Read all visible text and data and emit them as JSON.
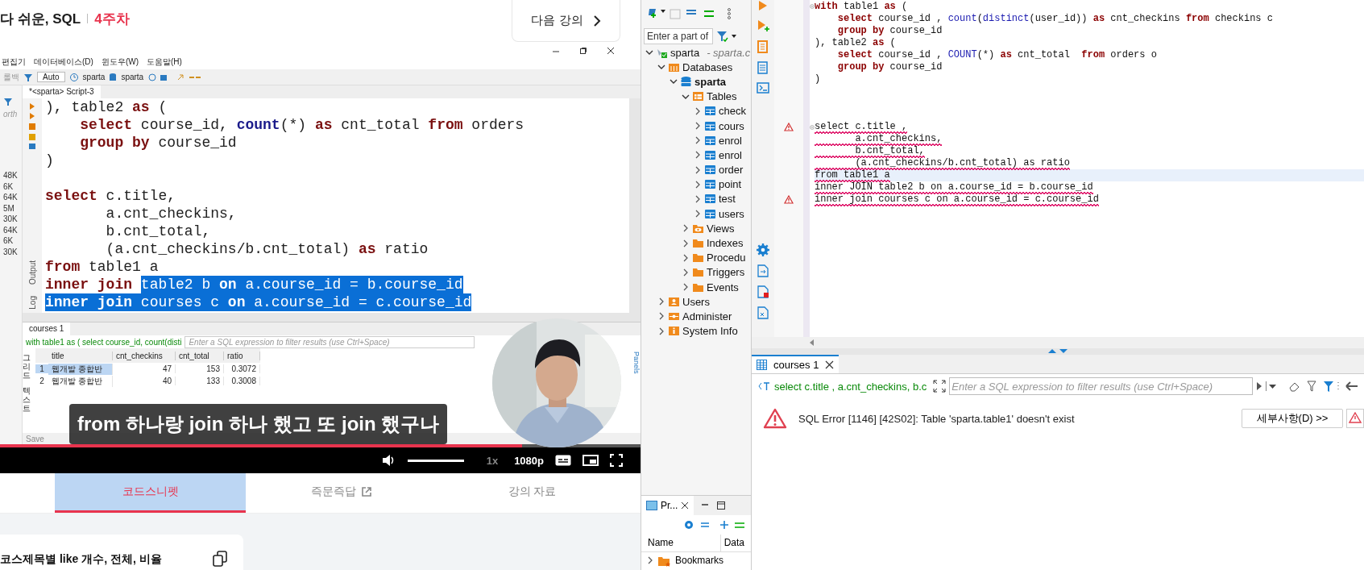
{
  "lesson_header": {
    "course": "다 쉬운, SQL",
    "week": "4주차",
    "next_button": "다음 강의"
  },
  "video": {
    "app": {
      "menu": [
        "편집기",
        "데이터베이스(D)",
        "윈도우(W)",
        "도움말(H)"
      ],
      "toolbar": {
        "rollback": "롤백",
        "commit_mode": "Auto",
        "datasource": "sparta",
        "schema": "sparta"
      },
      "side_label": "orth",
      "side_values": [
        "48K",
        "6K",
        "64K",
        "5M",
        "30K",
        "64K",
        "6K",
        "30K"
      ],
      "editor_tab": "*<sparta> Script-3",
      "code": [
        {
          "kind": "code",
          "parts": [
            {
              "selected": false,
              "tokens": [
                {
                  "kind": "text",
                  "text": "), table2 "
                },
                {
                  "kind": "keyword",
                  "text": "as"
                },
                {
                  "kind": "text",
                  "text": " ("
                }
              ]
            }
          ]
        },
        {
          "kind": "code",
          "parts": [
            {
              "selected": false,
              "tokens": [
                {
                  "kind": "keyword",
                  "text": "    select"
                },
                {
                  "kind": "text",
                  "text": " course_id, "
                },
                {
                  "kind": "function",
                  "text": "count"
                },
                {
                  "kind": "text",
                  "text": "(*) "
                },
                {
                  "kind": "keyword",
                  "text": "as"
                },
                {
                  "kind": "text",
                  "text": " cnt_total "
                },
                {
                  "kind": "keyword",
                  "text": "from"
                },
                {
                  "kind": "text",
                  "text": " orders"
                }
              ]
            }
          ]
        },
        {
          "kind": "code",
          "parts": [
            {
              "selected": false,
              "tokens": [
                {
                  "kind": "keyword",
                  "text": "    group by"
                },
                {
                  "kind": "text",
                  "text": " course_id"
                }
              ]
            }
          ]
        },
        {
          "kind": "code",
          "parts": [
            {
              "selected": false,
              "tokens": [
                {
                  "kind": "text",
                  "text": ")"
                }
              ]
            }
          ]
        },
        {
          "kind": "blank"
        },
        {
          "kind": "code",
          "parts": [
            {
              "selected": false,
              "tokens": [
                {
                  "kind": "keyword",
                  "text": "select"
                },
                {
                  "kind": "text",
                  "text": " c.title,"
                }
              ]
            }
          ]
        },
        {
          "kind": "code",
          "parts": [
            {
              "selected": false,
              "tokens": [
                {
                  "kind": "text",
                  "text": "       a.cnt_checkins,"
                }
              ]
            }
          ]
        },
        {
          "kind": "code",
          "parts": [
            {
              "selected": false,
              "tokens": [
                {
                  "kind": "text",
                  "text": "       b.cnt_total,"
                }
              ]
            }
          ]
        },
        {
          "kind": "code",
          "parts": [
            {
              "selected": false,
              "tokens": [
                {
                  "kind": "text",
                  "text": "       (a.cnt_checkins/b.cnt_total) "
                },
                {
                  "kind": "keyword",
                  "text": "as"
                },
                {
                  "kind": "text",
                  "text": " ratio"
                }
              ]
            }
          ]
        },
        {
          "kind": "code",
          "parts": [
            {
              "selected": false,
              "tokens": [
                {
                  "kind": "keyword",
                  "text": "from"
                },
                {
                  "kind": "text",
                  "text": " table1 a"
                }
              ]
            }
          ]
        },
        {
          "kind": "code",
          "parts": [
            {
              "selected": false,
              "tokens": [
                {
                  "kind": "keyword",
                  "text": "inner join "
                }
              ]
            },
            {
              "selected": true,
              "tokens": [
                {
                  "kind": "text",
                  "text": "table2 b "
                },
                {
                  "kind": "keyword",
                  "text": "on"
                },
                {
                  "kind": "text",
                  "text": " a.course_id = b.course_id"
                }
              ]
            }
          ]
        },
        {
          "kind": "code",
          "parts": [
            {
              "selected": true,
              "tokens": [
                {
                  "kind": "keyword",
                  "text": "inner join"
                },
                {
                  "kind": "text",
                  "text": " courses c "
                },
                {
                  "kind": "keyword",
                  "text": "on"
                },
                {
                  "kind": "text",
                  "text": " a.course_id = c.course_id"
                }
              ]
            }
          ]
        }
      ],
      "side_tabs": [
        "Output",
        "Log"
      ],
      "results": {
        "tab": "courses 1",
        "query": "with table1 as ( select course_id, count(disti",
        "filter_placeholder": "Enter a SQL expression to filter results (use Ctrl+Space)",
        "view_tabs": [
          "그리드",
          "텍스트"
        ],
        "columns": [
          "title",
          "cnt_checkins",
          "cnt_total",
          "ratio"
        ],
        "rows": [
          {
            "selected": true,
            "number": "1",
            "cells": [
              "웹개발 종합반",
              "47",
              "153",
              "0.3072"
            ]
          },
          {
            "selected": false,
            "number": "2",
            "cells": [
              "웹개발 종합반",
              "40",
              "133",
              "0.3008"
            ]
          }
        ],
        "panels_label": "Panels",
        "toolbar": [
          "Save"
        ]
      }
    },
    "subtitle": "from 하나랑 join 하나 했고 또 join 했구나",
    "progress": {
      "level": 0.815
    },
    "volume": {
      "level": 1
    },
    "speed": "1x",
    "quality": "1080p"
  },
  "lesson_tabs": [
    {
      "label": "코드스니펫",
      "selected": true,
      "external": false
    },
    {
      "label": "즉문즉답",
      "selected": false,
      "external": true
    },
    {
      "label": "강의 자료",
      "selected": false,
      "external": false
    }
  ],
  "snippet_card": {
    "title": "코스제목별 like 개수, 전체, 비율"
  },
  "navigator": {
    "search_placeholder": "Enter a part of",
    "tree": [
      {
        "label": "sparta",
        "detail": "- sparta.c",
        "kind": "connection",
        "expanded": true,
        "children": [
          {
            "label": "Databases",
            "kind": "databases",
            "expanded": true,
            "children": [
              {
                "label": "sparta",
                "kind": "database",
                "expanded": true,
                "children": [
                  {
                    "label": "Tables",
                    "kind": "tables",
                    "expanded": true,
                    "children": [
                      {
                        "label": "check",
                        "kind": "table",
                        "expanded": false
                      },
                      {
                        "label": "cours",
                        "kind": "table",
                        "expanded": false
                      },
                      {
                        "label": "enrol",
                        "kind": "table",
                        "expanded": false
                      },
                      {
                        "label": "enrol",
                        "kind": "table",
                        "expanded": false
                      },
                      {
                        "label": "order",
                        "kind": "table",
                        "expanded": false
                      },
                      {
                        "label": "point",
                        "kind": "table",
                        "expanded": false
                      },
                      {
                        "label": "test",
                        "kind": "table",
                        "expanded": false
                      },
                      {
                        "label": "users",
                        "kind": "table",
                        "expanded": false
                      }
                    ]
                  },
                  {
                    "label": "Views",
                    "kind": "views",
                    "expanded": false
                  },
                  {
                    "label": "Indexes",
                    "kind": "folder",
                    "expanded": false
                  },
                  {
                    "label": "Procedu",
                    "kind": "folder",
                    "expanded": false
                  },
                  {
                    "label": "Triggers",
                    "kind": "folder",
                    "expanded": false
                  },
                  {
                    "label": "Events",
                    "kind": "folder",
                    "expanded": false
                  }
                ]
              }
            ]
          },
          {
            "label": "Users",
            "kind": "users",
            "expanded": false
          },
          {
            "label": "Administer",
            "kind": "administer",
            "expanded": false
          },
          {
            "label": "System Info",
            "kind": "info",
            "expanded": false
          }
        ]
      }
    ]
  },
  "projects": {
    "tab": "Pr...",
    "columns": [
      "Name",
      "Data"
    ],
    "items": [
      {
        "label": "Bookmarks",
        "expanded": false
      }
    ]
  },
  "editor": {
    "lines": [
      {
        "kind": "code",
        "error": false,
        "squiggly": false,
        "current": false,
        "tokens": [
          {
            "kind": "keyword",
            "text": "with"
          },
          {
            "kind": "text",
            "text": " table1 "
          },
          {
            "kind": "keyword",
            "text": "as"
          },
          {
            "kind": "text",
            "text": " ("
          }
        ]
      },
      {
        "kind": "code",
        "error": false,
        "squiggly": false,
        "current": false,
        "tokens": [
          {
            "kind": "keyword",
            "text": "    select"
          },
          {
            "kind": "text",
            "text": " course_id , "
          },
          {
            "kind": "function",
            "text": "count"
          },
          {
            "kind": "text",
            "text": "("
          },
          {
            "kind": "function",
            "text": "distinct"
          },
          {
            "kind": "text",
            "text": "(user_id)) "
          },
          {
            "kind": "keyword",
            "text": "as"
          },
          {
            "kind": "text",
            "text": " cnt_checkins "
          },
          {
            "kind": "keyword",
            "text": "from"
          },
          {
            "kind": "text",
            "text": " checkins c"
          }
        ]
      },
      {
        "kind": "code",
        "error": false,
        "squiggly": false,
        "current": false,
        "tokens": [
          {
            "kind": "keyword",
            "text": "    group by"
          },
          {
            "kind": "text",
            "text": " course_id"
          }
        ]
      },
      {
        "kind": "code",
        "error": false,
        "squiggly": false,
        "current": false,
        "tokens": [
          {
            "kind": "text",
            "text": "), table2 "
          },
          {
            "kind": "keyword",
            "text": "as"
          },
          {
            "kind": "text",
            "text": " ("
          }
        ]
      },
      {
        "kind": "code",
        "error": false,
        "squiggly": false,
        "current": false,
        "tokens": [
          {
            "kind": "keyword",
            "text": "    select"
          },
          {
            "kind": "text",
            "text": " course_id , "
          },
          {
            "kind": "function",
            "text": "COUNT"
          },
          {
            "kind": "text",
            "text": "(*) "
          },
          {
            "kind": "keyword",
            "text": "as"
          },
          {
            "kind": "text",
            "text": " cnt_total  "
          },
          {
            "kind": "keyword",
            "text": "from"
          },
          {
            "kind": "text",
            "text": " orders o"
          }
        ]
      },
      {
        "kind": "code",
        "error": false,
        "squiggly": false,
        "current": false,
        "tokens": [
          {
            "kind": "keyword",
            "text": "    group by"
          },
          {
            "kind": "text",
            "text": " course_id"
          }
        ]
      },
      {
        "kind": "code",
        "error": false,
        "squiggly": false,
        "current": false,
        "tokens": [
          {
            "kind": "text",
            "text": ")"
          }
        ]
      },
      {
        "kind": "blank"
      },
      {
        "kind": "blank"
      },
      {
        "kind": "blank"
      },
      {
        "kind": "code",
        "error": true,
        "squiggly": true,
        "current": false,
        "tokens": [
          {
            "kind": "text",
            "text": "select c.title ,"
          }
        ]
      },
      {
        "kind": "code",
        "error": false,
        "squiggly": true,
        "current": false,
        "tokens": [
          {
            "kind": "text",
            "text": "       a.cnt_checkins,"
          }
        ]
      },
      {
        "kind": "code",
        "error": false,
        "squiggly": true,
        "current": false,
        "tokens": [
          {
            "kind": "text",
            "text": "       b.cnt_total,"
          }
        ]
      },
      {
        "kind": "code",
        "error": false,
        "squiggly": true,
        "current": false,
        "tokens": [
          {
            "kind": "text",
            "text": "       (a.cnt_checkins/b.cnt_total) as ratio"
          }
        ]
      },
      {
        "kind": "code",
        "error": false,
        "squiggly": true,
        "current": true,
        "tokens": [
          {
            "kind": "text",
            "text": "from table1 a"
          }
        ]
      },
      {
        "kind": "code",
        "error": false,
        "squiggly": true,
        "current": false,
        "tokens": [
          {
            "kind": "text",
            "text": "inner JOIN table2 b on a.course_id = b.course_id"
          }
        ]
      },
      {
        "kind": "code",
        "error": true,
        "squiggly": true,
        "current": false,
        "tokens": [
          {
            "kind": "text",
            "text": "inner join courses c on a.course_id = c.course_id"
          }
        ]
      }
    ]
  },
  "results": {
    "tab": "courses 1",
    "query": "select c.title , a.cnt_checkins, b.c",
    "filter_placeholder": "Enter a SQL expression to filter results (use Ctrl+Space)",
    "error": "SQL Error [1146] [42S02]: Table 'sparta.table1' doesn't exist",
    "details_button": "세부사항(D) >>"
  }
}
